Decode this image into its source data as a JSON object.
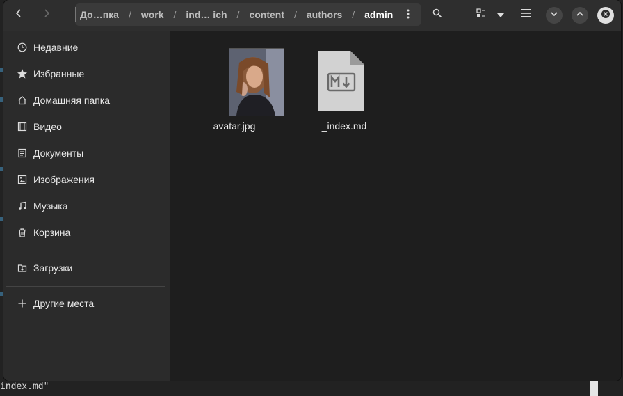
{
  "background_terminal": {
    "bottom_line": "index.md\""
  },
  "header": {
    "back_icon": "chevron-left-icon",
    "forward_icon": "chevron-right-icon",
    "breadcrumb": [
      {
        "label": "До…пка"
      },
      {
        "label": "work"
      },
      {
        "label": "ind… ich"
      },
      {
        "label": "content"
      },
      {
        "label": "authors"
      },
      {
        "label": "admin",
        "current": true
      }
    ],
    "separator": "/",
    "path_menu_icon": "vertical-ellipsis-icon",
    "search_icon": "search-icon",
    "view_icon": "list-view-icon",
    "view_dropdown_icon": "caret-down-icon",
    "menu_icon": "hamburger-icon",
    "minimize_icon": "chevron-down-icon",
    "maximize_icon": "chevron-up-icon",
    "close_icon": "close-icon"
  },
  "sidebar": {
    "items": [
      {
        "label": "Недавние",
        "icon": "clock-icon"
      },
      {
        "label": "Избранные",
        "icon": "star-icon"
      },
      {
        "label": "Домашняя папка",
        "icon": "home-icon"
      },
      {
        "label": "Видео",
        "icon": "video-icon"
      },
      {
        "label": "Документы",
        "icon": "document-icon"
      },
      {
        "label": "Изображения",
        "icon": "image-icon"
      },
      {
        "label": "Музыка",
        "icon": "music-icon"
      },
      {
        "label": "Корзина",
        "icon": "trash-icon"
      }
    ],
    "downloads": {
      "label": "Загрузки",
      "icon": "downloads-icon"
    },
    "other_places": {
      "label": "Другие места",
      "icon": "plus-icon"
    }
  },
  "files": [
    {
      "name": "avatar.jpg",
      "type": "image"
    },
    {
      "name": "_index.md",
      "type": "markdown"
    }
  ],
  "colors": {
    "window_bg": "#262626",
    "sidebar_bg": "#2b2b2b",
    "content_bg": "#1e1e1e",
    "text": "#e8e8e8"
  }
}
